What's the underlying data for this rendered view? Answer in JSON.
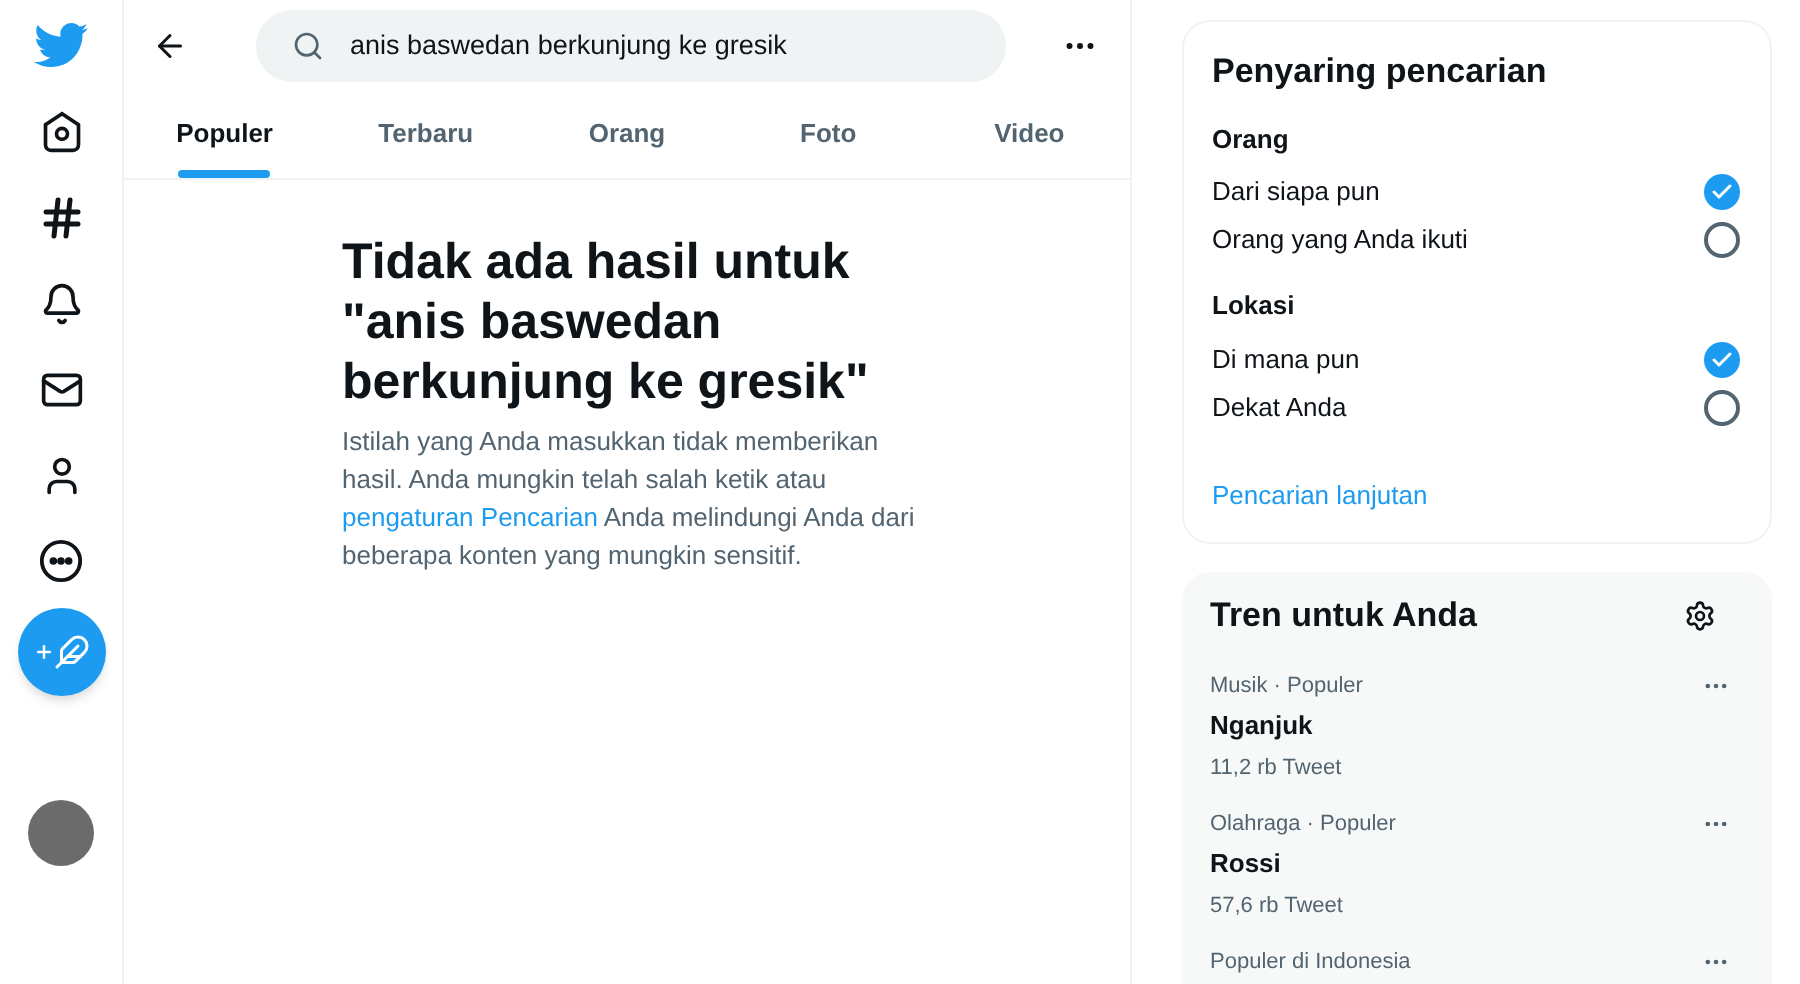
{
  "search": {
    "value": "anis baswedan berkunjung ke gresik"
  },
  "tabs": [
    {
      "label": "Populer",
      "selected": true
    },
    {
      "label": "Terbaru",
      "selected": false
    },
    {
      "label": "Orang",
      "selected": false
    },
    {
      "label": "Foto",
      "selected": false
    },
    {
      "label": "Video",
      "selected": false
    }
  ],
  "empty_state": {
    "title": "Tidak ada hasil untuk \"anis baswedan berkunjung ke gresik\"",
    "text_before": "Istilah yang Anda masukkan tidak memberikan hasil. Anda mungkin telah salah ketik atau",
    "link": "pengaturan Pencarian",
    "text_after": "Anda melindungi Anda dari beberapa konten yang mungkin sensitif."
  },
  "filters": {
    "title": "Penyaring pencarian",
    "groups": [
      {
        "label": "Orang",
        "options": [
          {
            "label": "Dari siapa pun",
            "selected": true
          },
          {
            "label": "Orang yang Anda ikuti",
            "selected": false
          }
        ]
      },
      {
        "label": "Lokasi",
        "options": [
          {
            "label": "Di mana pun",
            "selected": true
          },
          {
            "label": "Dekat Anda",
            "selected": false
          }
        ]
      }
    ],
    "advanced_link": "Pencarian lanjutan"
  },
  "trends": {
    "title": "Tren untuk Anda",
    "items": [
      {
        "context": "Musik · Populer",
        "name": "Nganjuk",
        "count": "11,2 rb Tweet"
      },
      {
        "context": "Olahraga · Populer",
        "name": "Rossi",
        "count": "57,6 rb Tweet"
      },
      {
        "context": "Populer di Indonesia"
      }
    ]
  }
}
